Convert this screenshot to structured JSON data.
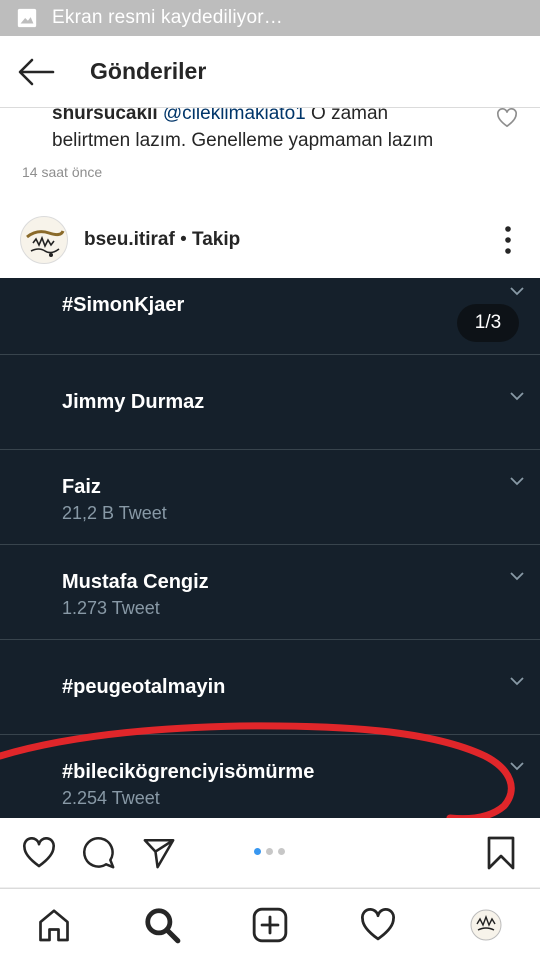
{
  "status_bar": {
    "notification_text": "Ekran resmi kaydediliyor…",
    "background": "#bdbdbd"
  },
  "header": {
    "title": "Gönderiler"
  },
  "comment": {
    "username": "shursucakli",
    "mention": "@cileklimakiato1",
    "text_line1": " O zaman",
    "text_line2": "belirtmen lazım. Genelleme yapmaman lazım",
    "time": "14 saat önce"
  },
  "post": {
    "author": "bseu.itiraf",
    "separator": " • ",
    "follow_label": "Takip",
    "media_counter": "1/3",
    "media_background": "#15202b",
    "trends": [
      {
        "name": "#SimonKjaer",
        "count": ""
      },
      {
        "name": "Jimmy Durmaz",
        "count": ""
      },
      {
        "name": "Faiz",
        "count": "21,2 B Tweet"
      },
      {
        "name": "Mustafa Cengiz",
        "count": "1.273 Tweet"
      },
      {
        "name": "#peugeotalmayin",
        "count": ""
      },
      {
        "name": "#bilecikögrenciyisömürme",
        "count": "2.254 Tweet"
      }
    ],
    "annotation_color": "#e0262a",
    "carousel": {
      "pages": 3,
      "active": 1
    }
  },
  "actions": {
    "like": "heart-icon",
    "comment": "comment-icon",
    "share": "send-icon",
    "save": "bookmark-icon"
  },
  "bottom_nav": {
    "items": [
      "home-icon",
      "search-icon",
      "add-icon",
      "activity-icon",
      "profile-avatar"
    ],
    "accent": "#262626"
  }
}
